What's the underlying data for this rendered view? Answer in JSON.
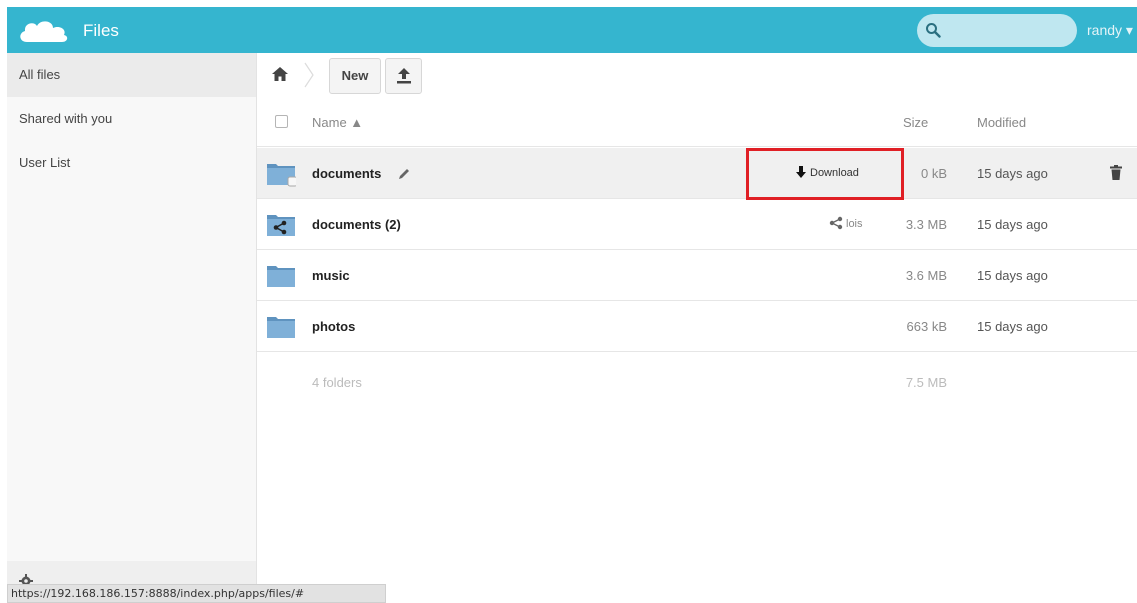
{
  "header": {
    "app_title": "Files",
    "search_placeholder": "",
    "user": "randy ▾",
    "bg_color": "#35b5cf"
  },
  "sidebar": {
    "items": [
      {
        "label": "All files",
        "active": true
      },
      {
        "label": "Shared with you",
        "active": false
      },
      {
        "label": "User List",
        "active": false
      }
    ],
    "settings_icon": "gear-icon"
  },
  "controls": {
    "new_label": "New",
    "upload_icon": "upload-icon",
    "home_icon": "home-icon"
  },
  "columns": {
    "name": "Name ▲",
    "size": "Size",
    "modified": "Modified"
  },
  "files": [
    {
      "name": "documents",
      "size": "0 kB",
      "modified": "15 days ago",
      "action": "Download",
      "icon": "folder-icon"
    },
    {
      "name": "documents (2)",
      "size": "3.3 MB",
      "modified": "15 days ago",
      "share_user": "lois",
      "icon": "shared-folder-icon"
    },
    {
      "name": "music",
      "size": "3.6 MB",
      "modified": "15 days ago",
      "icon": "folder-icon"
    },
    {
      "name": "photos",
      "size": "663 kB",
      "modified": "15 days ago",
      "icon": "folder-icon"
    }
  ],
  "summary": {
    "count": "4 folders",
    "total": "7.5 MB"
  },
  "statusbar": {
    "url": "https://192.168.186.157:8888/index.php/apps/files/#"
  },
  "colors": {
    "accent": "#35b5cf",
    "highlight": "#e01f25",
    "folder": "#6ea3cc"
  }
}
